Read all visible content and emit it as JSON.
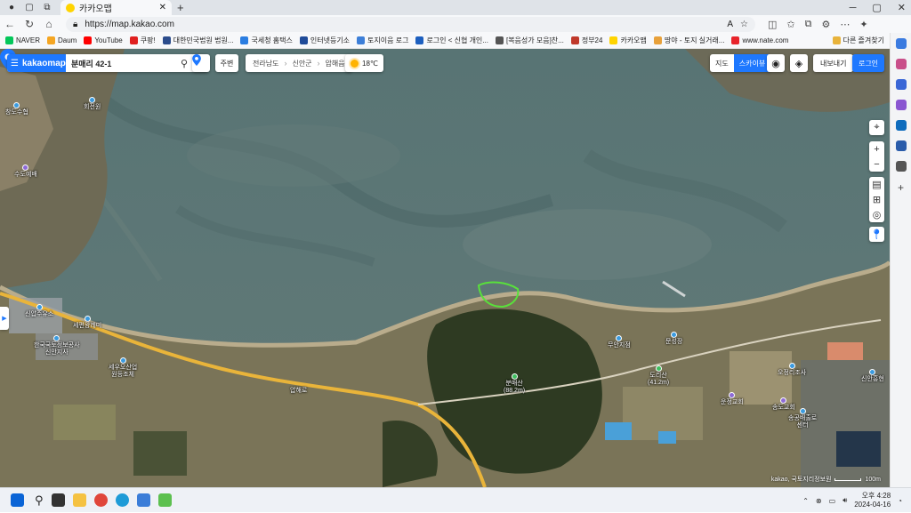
{
  "browser": {
    "tab_title": "카카오맵",
    "url": "https://map.kakao.com",
    "bookmarks": [
      {
        "label": "NAVER",
        "color": "#03c75a"
      },
      {
        "label": "Daum",
        "color": "#f5a623"
      },
      {
        "label": "YouTube",
        "color": "#ff0000"
      },
      {
        "label": "쿠팡!",
        "color": "#e02020"
      },
      {
        "label": "대한민국법원 법원...",
        "color": "#2b4c8c"
      },
      {
        "label": "국세청 홈택스",
        "color": "#2a7de1"
      },
      {
        "label": "인터넷등기소",
        "color": "#1f4b99"
      },
      {
        "label": "토지이음 로그",
        "color": "#3d7fd8"
      },
      {
        "label": "로그인 < 신협 개인...",
        "color": "#1d5fbf"
      },
      {
        "label": "[복음성가 모음]찬...",
        "color": "#555555"
      },
      {
        "label": "정부24",
        "color": "#c0392b"
      },
      {
        "label": "카카오맵",
        "color": "#ffd400"
      },
      {
        "label": "땅야 - 토지 실거래...",
        "color": "#e8a13b"
      },
      {
        "label": "www.nate.com",
        "color": "#e8242b"
      }
    ],
    "other_favorites": "다른 즐겨찾기"
  },
  "map": {
    "logo": "kakaomap",
    "search_value": "분매리 42-1",
    "nearby_label": "주변",
    "breadcrumb": [
      "전라남도",
      "신안군",
      "압해읍"
    ],
    "weather_temp": "18℃",
    "map_types": [
      {
        "label": "지도",
        "active": false
      },
      {
        "label": "스카이뷰",
        "active": true
      }
    ],
    "export_label": "내보내기",
    "login_label": "로그인",
    "places": [
      {
        "name": "창도수협",
        "sub": "",
        "dot": "blue"
      },
      {
        "name": "회전원",
        "sub": "",
        "dot": "blue"
      },
      {
        "name": "수도예배",
        "sub": "",
        "dot": "purple"
      },
      {
        "name": "신압주유소",
        "sub": "",
        "dot": "blue"
      },
      {
        "name": "세편왕레미",
        "sub": "",
        "dot": "blue"
      },
      {
        "name": "한국국토정보공사",
        "sub": "신안지사",
        "dot": "blue"
      },
      {
        "name": "세우오산업",
        "sub": "원등조체",
        "dot": "blue"
      },
      {
        "name": "분매산",
        "sub": "(88.2m)",
        "dot": "green"
      },
      {
        "name": "무안지점",
        "sub": "",
        "dot": "blue"
      },
      {
        "name": "문성장",
        "sub": "",
        "dot": "blue"
      },
      {
        "name": "도리산",
        "sub": "(41.2m)",
        "dot": "green"
      },
      {
        "name": "운정교회",
        "sub": "",
        "dot": "purple"
      },
      {
        "name": "오정리조사",
        "sub": "",
        "dot": "blue"
      },
      {
        "name": "송도교회",
        "sub": "",
        "dot": "purple"
      },
      {
        "name": "송공배출로",
        "sub": "센터",
        "dot": "blue"
      },
      {
        "name": "신안흥현",
        "sub": "",
        "dot": "blue"
      }
    ],
    "road_label": "압해로",
    "copyright": "kakao, 국토지리정보원",
    "scale_label": "100m",
    "colors": {
      "accent": "#1e78ff",
      "sea": "#5b7677",
      "land": "#6d6a55",
      "road": "#e9b43a"
    }
  },
  "taskbar": {
    "time": "오후 4:28",
    "date": "2024-04-16"
  }
}
